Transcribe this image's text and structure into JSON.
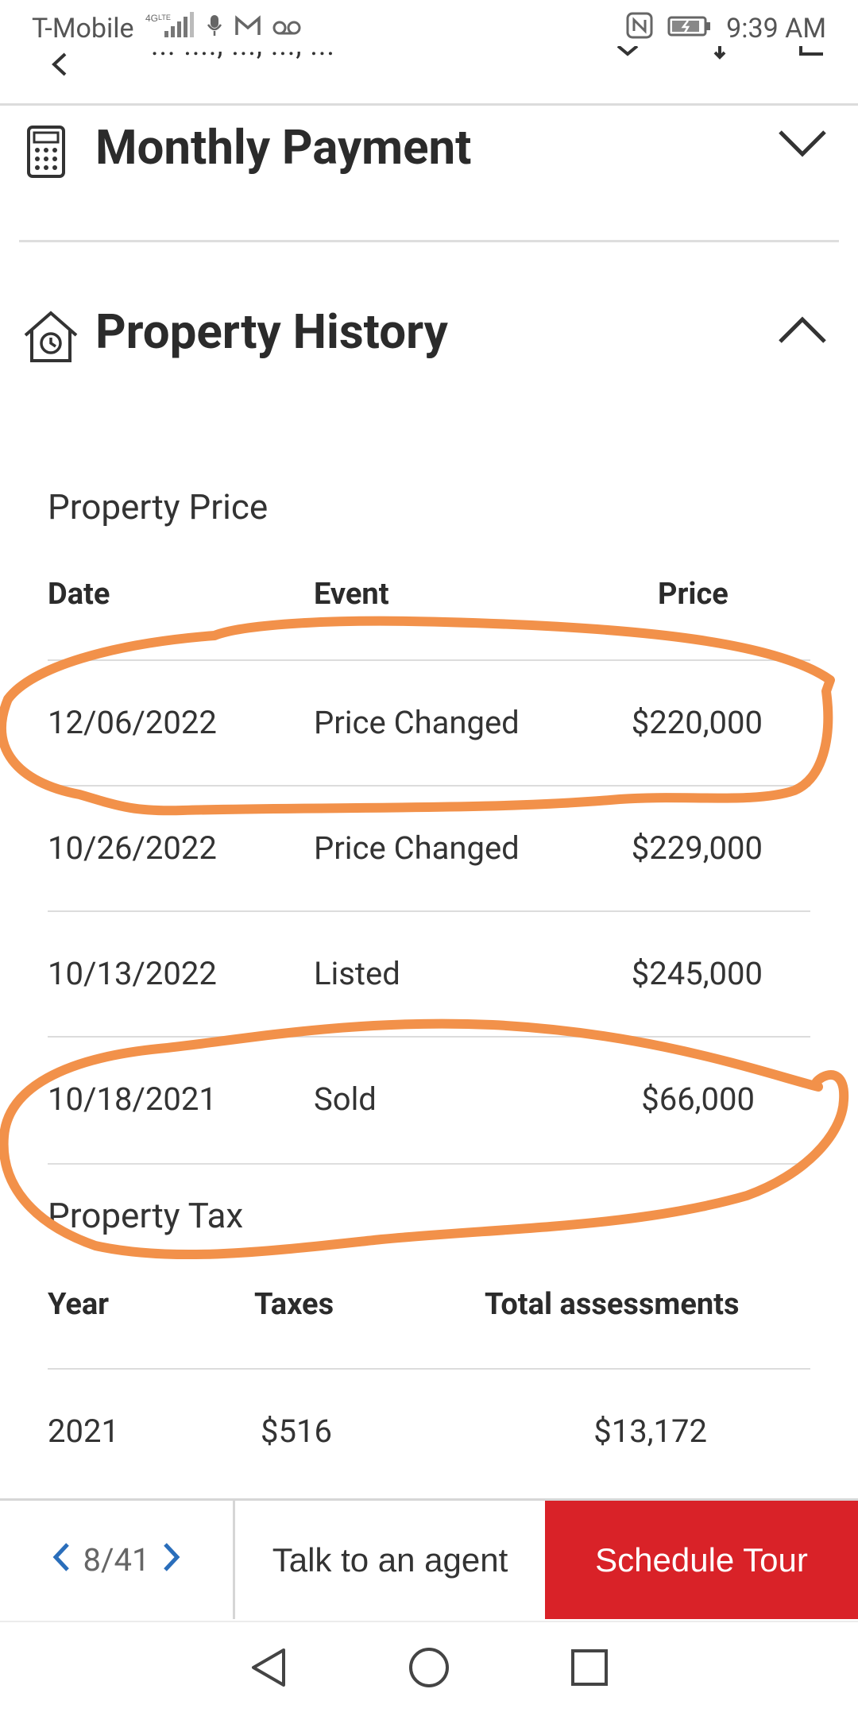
{
  "status_bar": {
    "carrier": "T-Mobile",
    "network": "4G LTE",
    "time": "9:39 AM"
  },
  "address_bar": {
    "address_fragment": "... ...., ..., ..., ..."
  },
  "sections": {
    "monthly_payment": {
      "title": "Monthly Payment",
      "state": "collapsed"
    },
    "property_history": {
      "title": "Property History",
      "state": "expanded"
    }
  },
  "property_price": {
    "heading": "Property Price",
    "columns": [
      "Date",
      "Event",
      "Price"
    ],
    "rows": [
      {
        "date": "12/06/2022",
        "event": "Price Changed",
        "price": "$220,000"
      },
      {
        "date": "10/26/2022",
        "event": "Price Changed",
        "price": "$229,000"
      },
      {
        "date": "10/13/2022",
        "event": "Listed",
        "price": "$245,000"
      },
      {
        "date": "10/18/2021",
        "event": "Sold",
        "price": "$66,000"
      }
    ]
  },
  "property_tax": {
    "heading": "Property Tax",
    "columns": [
      "Year",
      "Taxes",
      "Total assessments"
    ],
    "rows": [
      {
        "year": "2021",
        "taxes": "$516",
        "assessment": "$13,172"
      }
    ]
  },
  "action_bar": {
    "pager_text": "8/41",
    "talk_label": "Talk to an agent",
    "tour_label": "Schedule Tour"
  },
  "colors": {
    "accent_red": "#d92228",
    "link_blue": "#2a6ebb",
    "annotation_orange": "#f2914a"
  }
}
